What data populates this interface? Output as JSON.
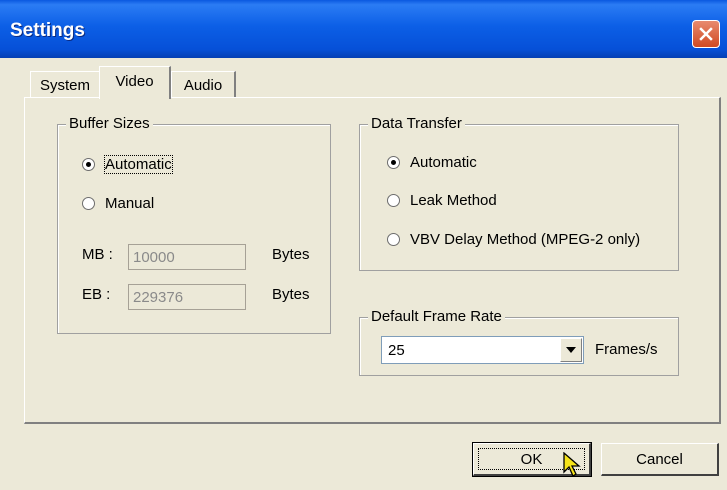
{
  "window": {
    "title": "Settings",
    "close_icon": "close-icon"
  },
  "tabs": [
    {
      "label": "System"
    },
    {
      "label": "Video",
      "selected": true
    },
    {
      "label": "Audio"
    }
  ],
  "buffer_sizes": {
    "legend": "Buffer Sizes",
    "options": [
      {
        "label": "Automatic",
        "checked": true
      },
      {
        "label": "Manual",
        "checked": false
      }
    ],
    "mb_label": "MB :",
    "mb_value": "10000",
    "eb_label": "EB :",
    "eb_value": "229376",
    "unit": "Bytes"
  },
  "data_transfer": {
    "legend": "Data Transfer",
    "options": [
      {
        "label": "Automatic",
        "checked": true
      },
      {
        "label": "Leak Method",
        "checked": false
      },
      {
        "label": "VBV Delay Method (MPEG-2 only)",
        "checked": false
      }
    ]
  },
  "frame_rate": {
    "legend": "Default Frame Rate",
    "value": "25",
    "unit": "Frames/s"
  },
  "buttons": {
    "ok": "OK",
    "cancel": "Cancel"
  },
  "colors": {
    "titlebar": "#0a58e0",
    "dialog_bg": "#ece9d8",
    "close": "#d04a22"
  }
}
